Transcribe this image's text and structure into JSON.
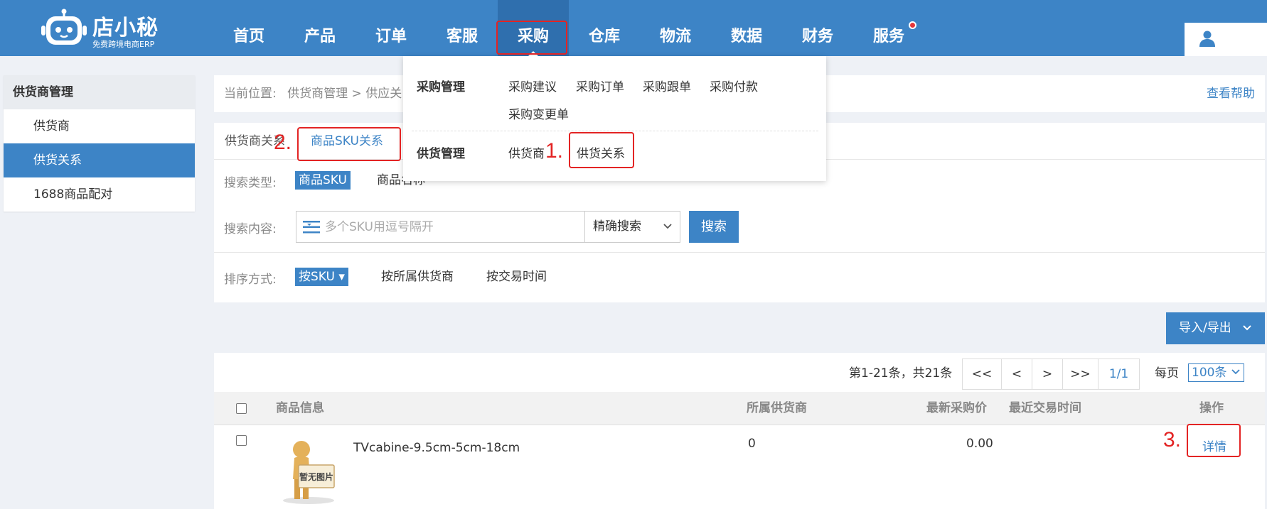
{
  "logo": {
    "title": "店小秘",
    "subtitle": "免费跨境电商ERP"
  },
  "nav": {
    "items": [
      "首页",
      "产品",
      "订单",
      "客服",
      "采购",
      "仓库",
      "物流",
      "数据",
      "财务",
      "服务"
    ],
    "active": "采购"
  },
  "sidebar": {
    "heading": "供货商管理",
    "items": [
      "供货商",
      "供货关系",
      "1688商品配对"
    ],
    "active": "供货关系"
  },
  "breadcrumb": {
    "prefix": "当前位置:",
    "path": "供货商管理 > 供应关",
    "help": "查看帮助"
  },
  "tabs": [
    "供货商关系",
    "商品SKU关系"
  ],
  "search": {
    "type_label": "搜索类型:",
    "type_options": [
      "商品SKU",
      "商品名称"
    ],
    "content_label": "搜索内容:",
    "placeholder": "多个SKU用逗号隔开",
    "match_mode": "精确搜索",
    "button": "搜索",
    "sort_label": "排序方式:",
    "sort_options": [
      "按SKU ▾",
      "按所属供货商",
      "按交易时间"
    ]
  },
  "io_button": "导入/导出",
  "pagination": {
    "summary": "第1-21条，共21条",
    "buttons": [
      "<<",
      "<",
      ">",
      ">>"
    ],
    "page": "1/1",
    "per_page_label": "每页",
    "per_page": "100条"
  },
  "table": {
    "columns": [
      "商品信息",
      "所属供货商",
      "最新采购价",
      "最近交易时间",
      "操作"
    ],
    "rows": [
      {
        "product_name": "TVcabine-9.5cm-5cm-18cm",
        "no_image_text": "暂无图片",
        "supplier": "0",
        "price": "0.00",
        "last_trade": "",
        "action": "详情"
      }
    ]
  },
  "dropdown": {
    "sections": [
      {
        "title": "采购管理",
        "items": [
          "采购建议",
          "采购订单",
          "采购跟单",
          "采购付款",
          "采购变更单"
        ]
      },
      {
        "title": "供货管理",
        "items": [
          "供货商",
          "供货关系"
        ]
      }
    ]
  },
  "annotations": [
    "1.",
    "2.",
    "3."
  ],
  "colors": {
    "brand": "#3d84c6",
    "annotation": "#e32424",
    "notice_dot": "#e5363a"
  }
}
